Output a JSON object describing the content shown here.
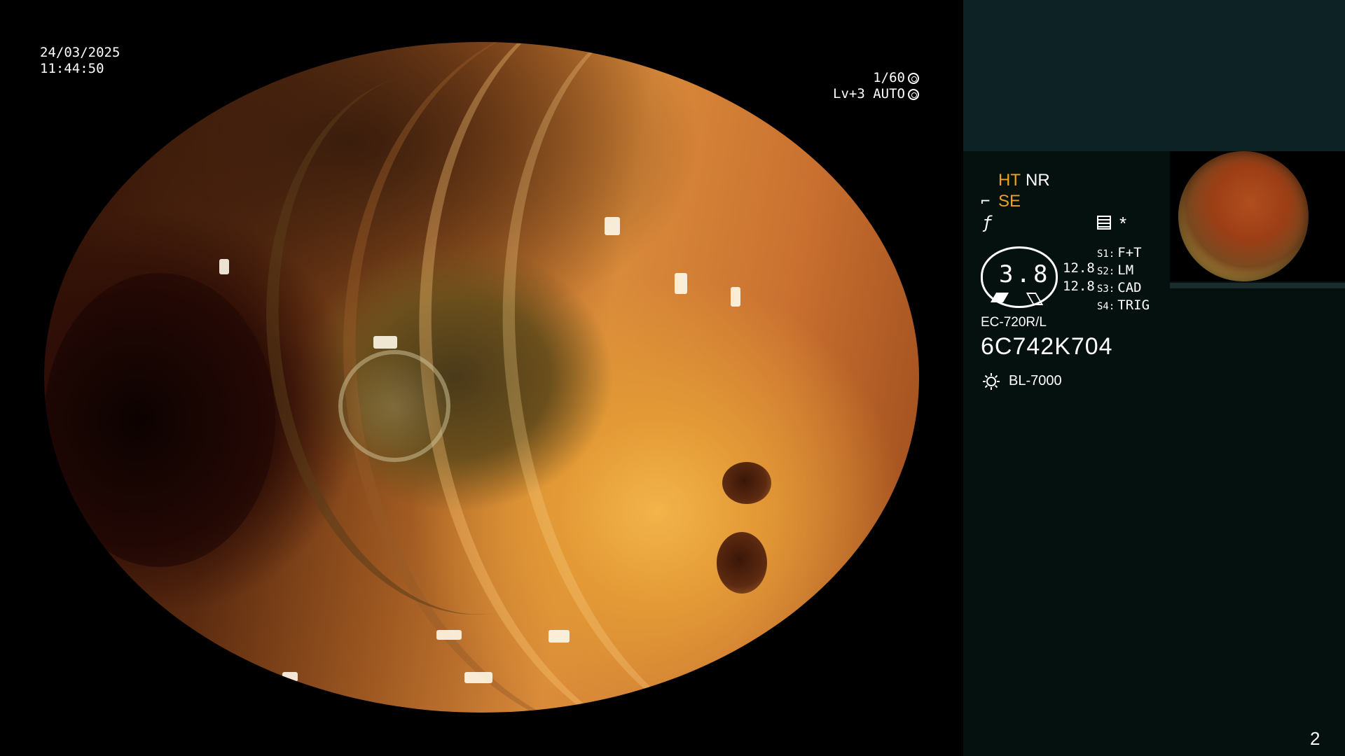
{
  "overlay": {
    "date": "24/03/2025",
    "time": "11:44:50",
    "shutter": "1/60",
    "iris": "Lv+3 AUTO"
  },
  "panel": {
    "mode_ht": "HT",
    "mode_nr": "NR",
    "mode_se": "SE",
    "dial_value": "3.8",
    "zoom_a": "12.8",
    "zoom_b": "12.8",
    "switches": [
      {
        "key": "S1:",
        "value": "F+T"
      },
      {
        "key": "S2:",
        "value": "LM"
      },
      {
        "key": "S3:",
        "value": "CAD"
      },
      {
        "key": "S4:",
        "value": "TRIG"
      }
    ],
    "scope_model": "EC-720R/L",
    "scope_serial": "6C742K704",
    "light_source": "BL-7000",
    "page_number": "2"
  },
  "icons": {
    "shutter": "aperture-icon",
    "iris": "iris-icon",
    "se": "scope-enhance-icon",
    "freeze": "freeze-icon",
    "menu": "menu-icon",
    "asterisk": "asterisk-icon",
    "light": "light-bulb-icon"
  },
  "colors": {
    "accent": "#f0a020",
    "panel_bg": "#05110f",
    "panel_top": "#0d2224"
  }
}
